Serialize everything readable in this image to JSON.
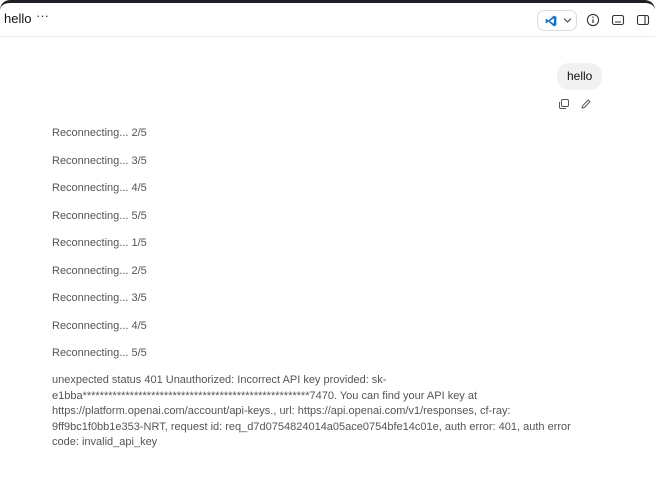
{
  "header": {
    "title": "hello",
    "more_glyph": "···",
    "model_icon": "vscode-icon",
    "actions": [
      "info-icon",
      "keyboard-icon",
      "sidebar-icon"
    ]
  },
  "conversation": {
    "user_message": "hello",
    "user_actions": [
      "copy-icon",
      "edit-icon"
    ],
    "log_lines": [
      "Reconnecting... 2/5",
      "Reconnecting... 3/5",
      "Reconnecting... 4/5",
      "Reconnecting... 5/5",
      "Reconnecting... 1/5",
      "Reconnecting... 2/5",
      "Reconnecting... 3/5",
      "Reconnecting... 4/5",
      "Reconnecting... 5/5"
    ],
    "error_text": "unexpected status 401 Unauthorized: Incorrect API key provided: sk-\ne1bba*****************************************************7470. You can find your API key at\nhttps://platform.openai.com/account/api-keys., url: https://api.openai.com/v1/responses, cf-ray:\n9ff9bc1f0bb1e353-NRT, request id: req_d7d0754824014a05ace0754bfe14c01e, auth error: 401, auth error\ncode: invalid_api_key"
  },
  "colors": {
    "accent": "#1a73c8",
    "text": "#555555",
    "bubble": "#f1f1f1"
  }
}
